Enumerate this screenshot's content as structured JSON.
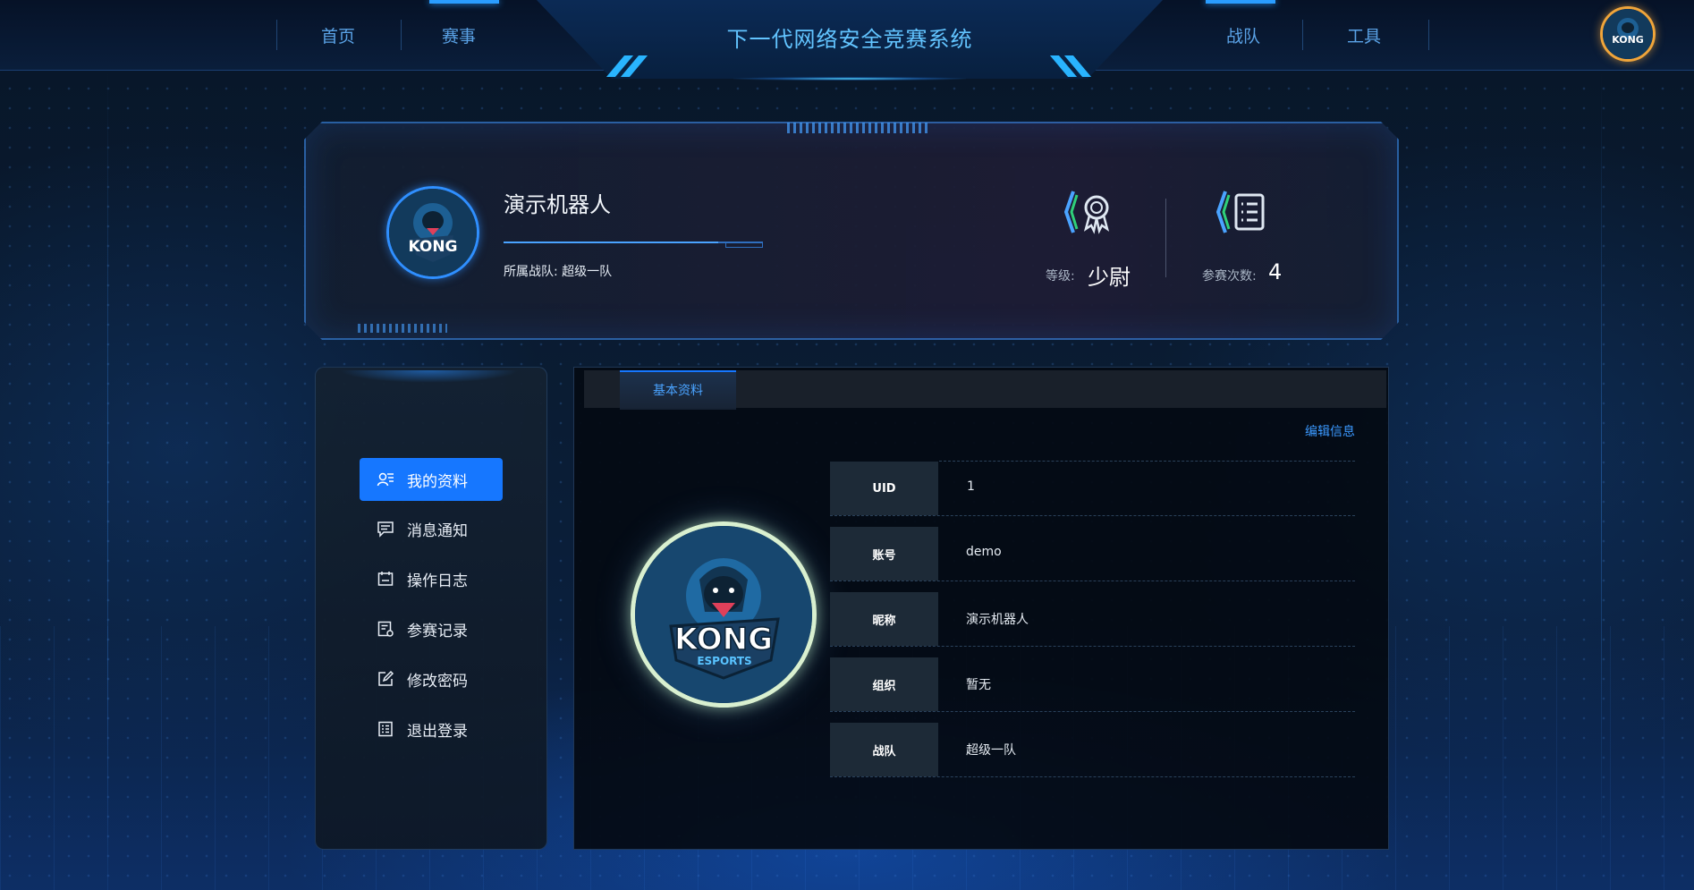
{
  "header": {
    "title": "下一代网络安全竞赛系统",
    "nav_left": [
      "首页",
      "赛事"
    ],
    "nav_right": [
      "战队",
      "工具"
    ],
    "avatar_text": "KONG"
  },
  "profile": {
    "username": "演示机器人",
    "team_label": "所属战队:",
    "team_name": "超级一队",
    "rank_label": "等级:",
    "rank_value": "少尉",
    "matches_label": "参赛次数:",
    "matches_value": "4",
    "avatar_text": "KONG",
    "avatar_subtext": "ESPORTS"
  },
  "sidebar": {
    "items": [
      {
        "label": "我的资料",
        "icon": "user-card-icon",
        "active": true
      },
      {
        "label": "消息通知",
        "icon": "message-icon",
        "active": false
      },
      {
        "label": "操作日志",
        "icon": "calendar-log-icon",
        "active": false
      },
      {
        "label": "参赛记录",
        "icon": "record-icon",
        "active": false
      },
      {
        "label": "修改密码",
        "icon": "edit-icon",
        "active": false
      },
      {
        "label": "退出登录",
        "icon": "logout-list-icon",
        "active": false
      }
    ]
  },
  "panel": {
    "tab": "基本资料",
    "edit_label": "编辑信息",
    "fields": [
      {
        "key": "UID",
        "value": "1"
      },
      {
        "key": "账号",
        "value": "demo"
      },
      {
        "key": "昵称",
        "value": "演示机器人"
      },
      {
        "key": "组织",
        "value": "暂无"
      },
      {
        "key": "战队",
        "value": "超级一队"
      }
    ]
  },
  "colors": {
    "accent": "#1677ff",
    "title": "#62c4ff",
    "avatar_ring_top": "#f0a53a",
    "avatar_ring_banner": "#2f8fff"
  }
}
